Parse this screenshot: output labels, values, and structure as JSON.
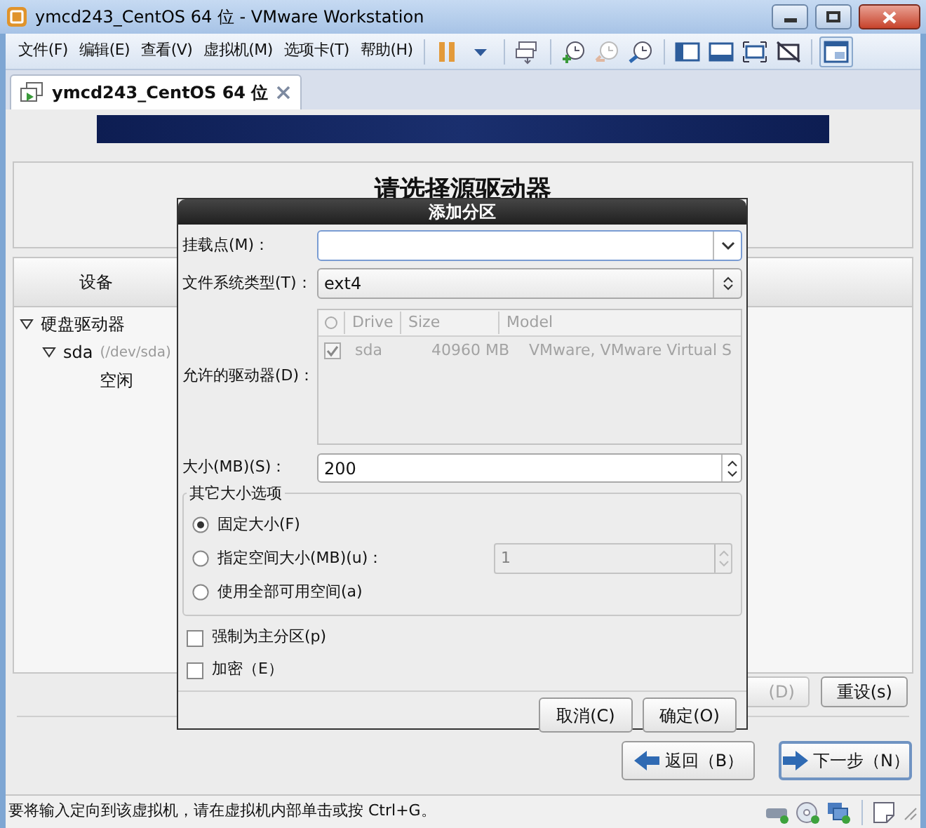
{
  "window": {
    "title": "ymcd243_CentOS 64 位 - VMware Workstation"
  },
  "menu": [
    "文件(F)",
    "编辑(E)",
    "查看(V)",
    "虚拟机(M)",
    "选项卡(T)",
    "帮助(H)"
  ],
  "tabs": [
    {
      "label": "ymcd243_CentOS 64 位",
      "selected": true
    }
  ],
  "installer": {
    "heading": "请选择源驱动器",
    "devices": {
      "column": "设备",
      "tree": [
        {
          "label": "硬盘驱动器",
          "expanded": true,
          "children": [
            {
              "label": "sda",
              "detail": "(/dev/sda)",
              "expanded": true,
              "children": [
                {
                  "label": "空闲"
                }
              ]
            }
          ]
        }
      ]
    },
    "buttons": [
      {
        "label": "(D)",
        "disabled": true
      },
      {
        "label": "重设(s)",
        "disabled": false
      }
    ],
    "nav": [
      {
        "label": "返回（B）",
        "kind": "back"
      },
      {
        "label": "下一步（N）",
        "kind": "next"
      }
    ]
  },
  "dialog": {
    "title": "添加分区",
    "mount_point": {
      "label": "挂载点(M)："
    },
    "fs_type": {
      "label": "文件系统类型(T)：",
      "value": "ext4"
    },
    "drives": {
      "label": "允许的驱动器(D)：",
      "columns": [
        "Drive",
        "Size",
        "Model"
      ],
      "rows": [
        {
          "checked": true,
          "drive": "sda",
          "size": "40960 MB",
          "model": "VMware, VMware Virtual S"
        }
      ]
    },
    "size": {
      "label": "大小(MB)(S)：",
      "value": "200"
    },
    "size_options": {
      "title": "其它大小选项",
      "options": [
        {
          "label": "固定大小(F)",
          "selected": true
        },
        {
          "label": "指定空间大小(MB)(u)：",
          "selected": false,
          "value": "1"
        },
        {
          "label": "使用全部可用空间(a)",
          "selected": false
        }
      ]
    },
    "checkboxes": [
      {
        "label": "强制为主分区(p)",
        "checked": false
      },
      {
        "label": "加密（E）",
        "checked": false
      }
    ],
    "buttons": [
      "取消(C)",
      "确定(O)"
    ]
  },
  "status_bar": {
    "text": "要将输入定向到该虚拟机，请在虚拟机内部单击或按 Ctrl+G。"
  }
}
